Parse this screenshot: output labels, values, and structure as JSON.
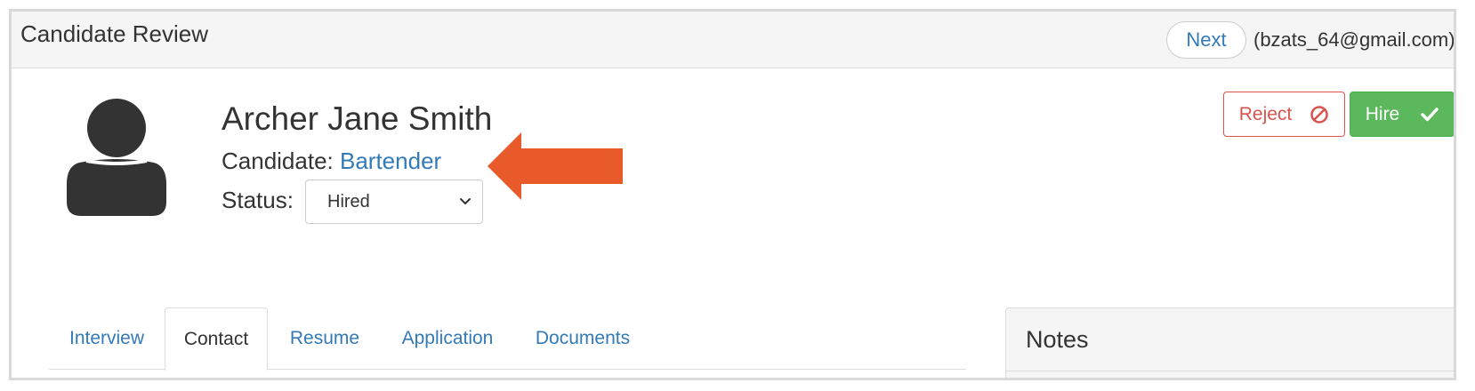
{
  "header": {
    "title": "Candidate Review",
    "next_label": "Next",
    "user_email": "(bzats_64@gmail.com)"
  },
  "candidate": {
    "name": "Archer Jane Smith",
    "candidate_label": "Candidate:",
    "position": "Bartender",
    "status_label": "Status:",
    "status_value": "Hired"
  },
  "actions": {
    "reject_label": "Reject",
    "hire_label": "Hire"
  },
  "tabs": [
    {
      "label": "Interview",
      "active": false
    },
    {
      "label": "Contact",
      "active": true
    },
    {
      "label": "Resume",
      "active": false
    },
    {
      "label": "Application",
      "active": false
    },
    {
      "label": "Documents",
      "active": false
    }
  ],
  "notes": {
    "title": "Notes"
  },
  "colors": {
    "link": "#337ab7",
    "reject": "#d9534f",
    "hire": "#5cb85c",
    "annotation_arrow": "#e85a2a",
    "avatar": "#333333"
  },
  "icons": {
    "reject": "ban-icon",
    "hire": "check-icon",
    "avatar": "user-silhouette-icon",
    "select": "chevron-down-icon",
    "annotation": "arrow-left-icon"
  }
}
